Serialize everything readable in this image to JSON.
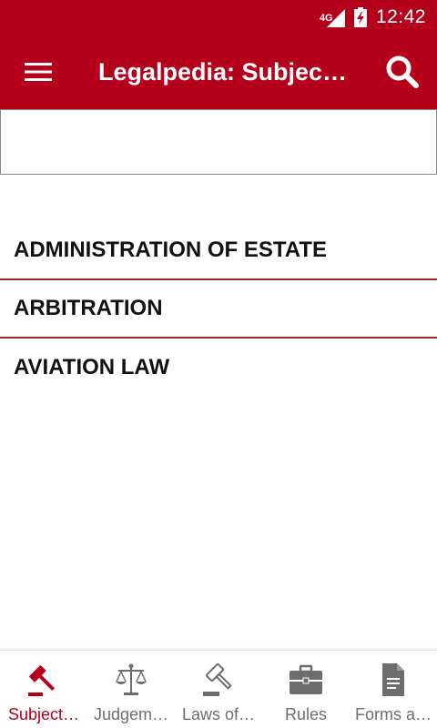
{
  "status_bar": {
    "network": "4G",
    "time": "12:42"
  },
  "app_bar": {
    "title": "Legalpedia: Subjec…",
    "menu_icon": "hamburger-menu-icon",
    "search_icon": "search-icon"
  },
  "search": {
    "value": "",
    "placeholder": ""
  },
  "subjects": [
    "ADMINISTRATION OF ESTATE",
    "ARBITRATION",
    "AVIATION LAW"
  ],
  "bottom_nav": [
    {
      "label": "Subject…",
      "icon": "gavel-icon",
      "active": true
    },
    {
      "label": "Judgem…",
      "icon": "scales-icon",
      "active": false
    },
    {
      "label": "Laws of…",
      "icon": "gavel-icon",
      "active": false
    },
    {
      "label": "Rules",
      "icon": "briefcase-icon",
      "active": false
    },
    {
      "label": "Forms a…",
      "icon": "document-icon",
      "active": false
    }
  ],
  "colors": {
    "primary": "#b5001b",
    "divider": "#9b2a1c",
    "inactive": "#6d6d6d"
  }
}
